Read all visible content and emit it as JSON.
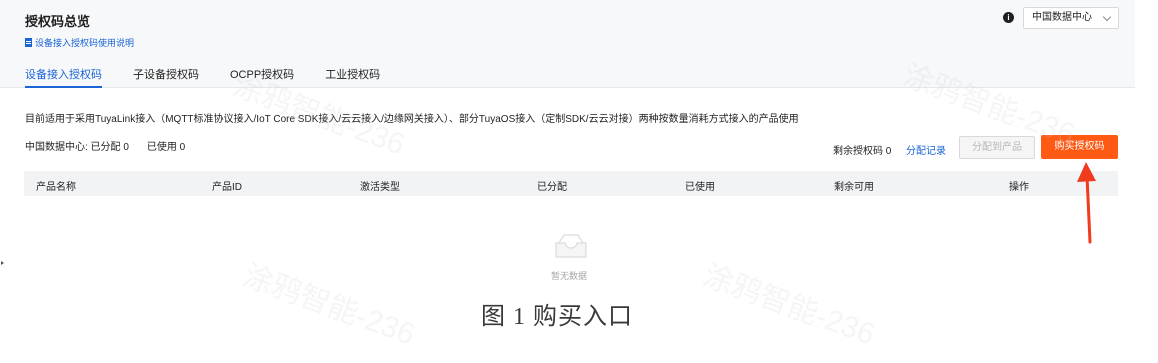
{
  "header": {
    "title": "授权码总览",
    "doc_link": "设备接入授权码使用说明",
    "info_icon": "info-icon",
    "datacenter": "中国数据中心"
  },
  "tabs": [
    {
      "label": "设备接入授权码",
      "active": true
    },
    {
      "label": "子设备授权码",
      "active": false
    },
    {
      "label": "OCPP授权码",
      "active": false
    },
    {
      "label": "工业授权码",
      "active": false
    }
  ],
  "description": "目前适用于采用TuyaLink接入（MQTT标准协议接入/IoT Core SDK接入/云云接入/边缘网关接入）、部分TuyaOS接入（定制SDK/云云对接）两种按数量消耗方式接入的产品使用",
  "stats": {
    "allocated": "中国数据中心: 已分配 0",
    "used": "已使用 0"
  },
  "actions": {
    "remaining": "剩余授权码 0",
    "record_link": "分配记录",
    "assign_button": "分配到产品",
    "buy_button": "购买授权码"
  },
  "table": {
    "columns": [
      "产品名称",
      "产品ID",
      "激活类型",
      "已分配",
      "已使用",
      "剩余可用",
      "操作"
    ],
    "rows": [],
    "empty_text": "暂无数据"
  },
  "caption": "图 1   购买入口",
  "watermark": "涂鸦智能-236",
  "colors": {
    "accent": "#1a64d6",
    "buy_button": "#ff5a14",
    "annotation_arrow": "#f03b1f"
  }
}
